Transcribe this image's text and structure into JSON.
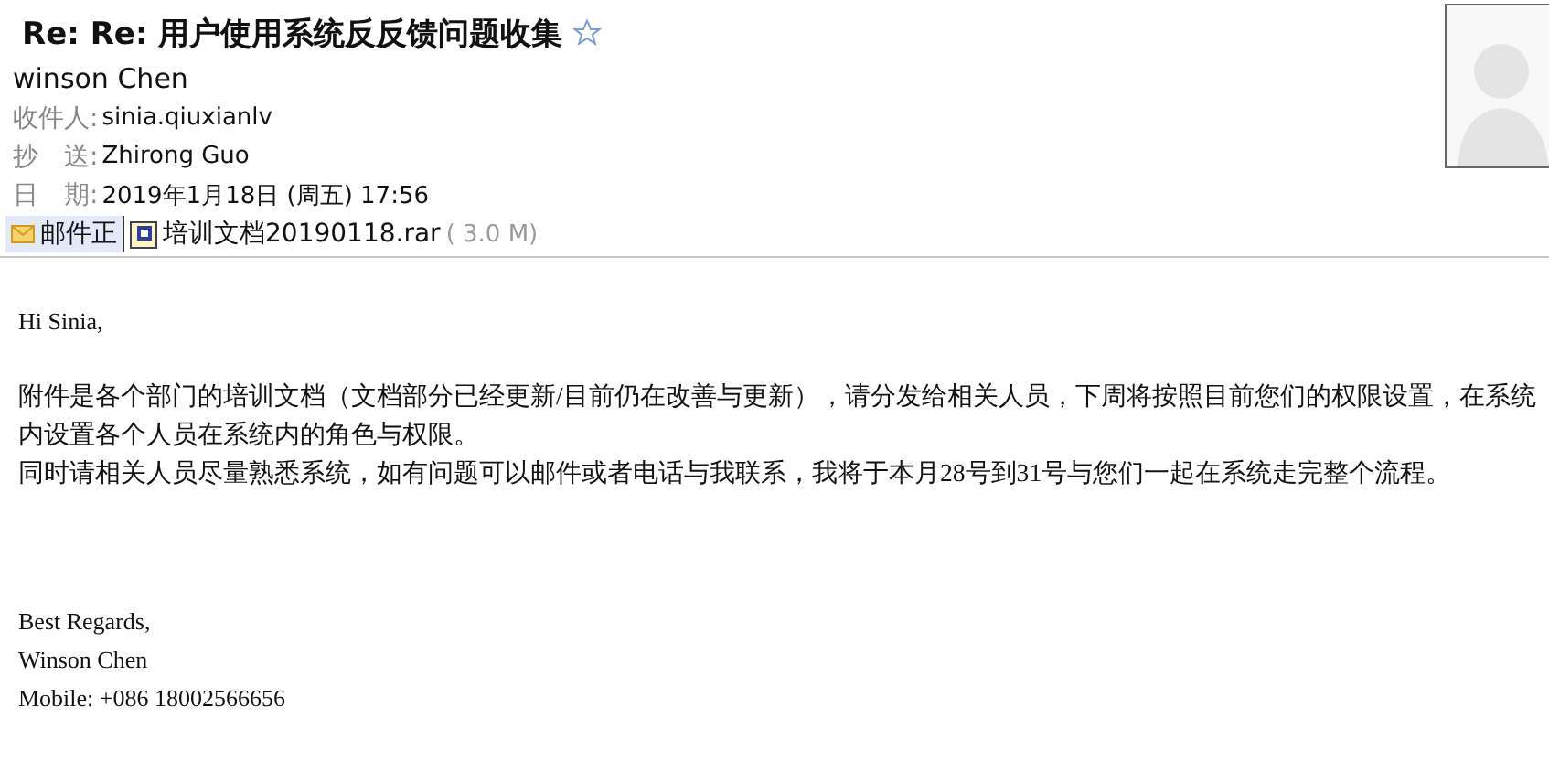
{
  "subject": {
    "title": "Re: Re: 用户使用系统反反馈问题收集",
    "starred": false
  },
  "sender": "winson Chen",
  "fields": [
    {
      "label": "收件人:",
      "value": "sinia.qiuxianlv"
    },
    {
      "label": "抄　送:",
      "value": "Zhirong Guo"
    },
    {
      "label": "日　期:",
      "value": "2019年1月18日 (周五) 17:56"
    }
  ],
  "tabs": [
    {
      "label": "邮件正",
      "selected": true,
      "kind": "body"
    },
    {
      "label": "培训文档20190118.rar",
      "size": "( 3.0 M)",
      "selected": false,
      "kind": "attachment"
    }
  ],
  "body": {
    "greeting": "Hi Sinia,",
    "paragraphs": [
      "附件是各个部门的培训文档（文档部分已经更新/目前仍在改善与更新），请分发给相关人员，下周将按照目前您们的权限设置，在系统内设置各个人员在系统内的角色与权限。",
      "同时请相关人员尽量熟悉系统，如有问题可以邮件或者电话与我联系，我将于本月28号到31号与您们一起在系统走完整个流程。"
    ],
    "signature": [
      "Best Regards,",
      "Winson Chen",
      "Mobile: +086 18002566656"
    ]
  }
}
